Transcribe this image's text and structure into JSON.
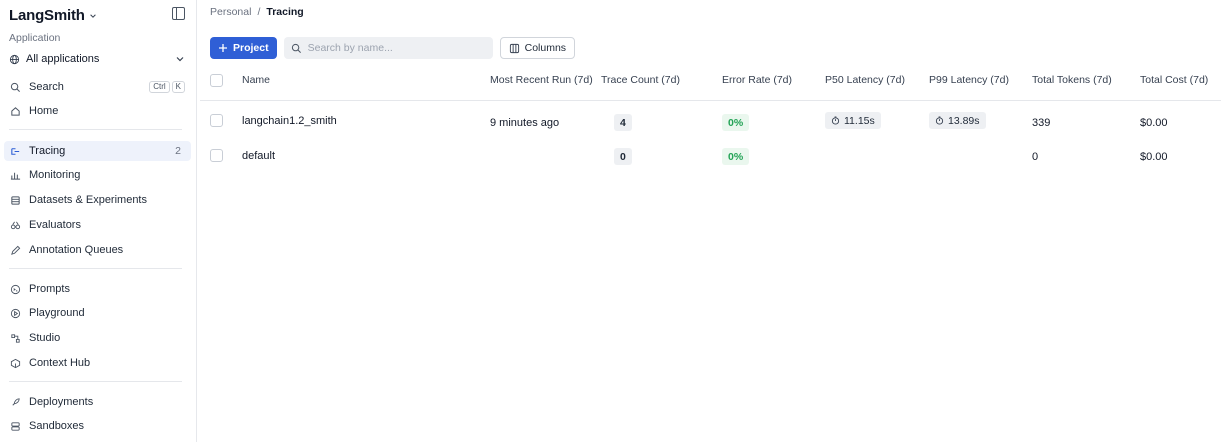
{
  "sidebar": {
    "brand": "LangSmith",
    "section_label": "Application",
    "app_selector": "All applications",
    "search": {
      "label": "Search",
      "kbd": [
        "Ctrl",
        "K"
      ]
    },
    "items": [
      {
        "label": "Home",
        "icon": "home-icon"
      },
      {
        "label": "Tracing",
        "icon": "tracing-icon",
        "count": "2"
      },
      {
        "label": "Monitoring",
        "icon": "monitoring-icon"
      },
      {
        "label": "Datasets & Experiments",
        "icon": "database-icon"
      },
      {
        "label": "Evaluators",
        "icon": "evaluators-icon"
      },
      {
        "label": "Annotation Queues",
        "icon": "pen-icon"
      },
      {
        "label": "Prompts",
        "icon": "prompt-icon"
      },
      {
        "label": "Playground",
        "icon": "playground-icon"
      },
      {
        "label": "Studio",
        "icon": "studio-icon"
      },
      {
        "label": "Context Hub",
        "icon": "hub-icon"
      },
      {
        "label": "Deployments",
        "icon": "rocket-icon"
      },
      {
        "label": "Sandboxes",
        "icon": "sandbox-icon"
      }
    ]
  },
  "breadcrumb": {
    "parent": "Personal",
    "separator": "/",
    "current": "Tracing"
  },
  "toolbar": {
    "project_label": "Project",
    "search_placeholder": "Search by name...",
    "columns_label": "Columns"
  },
  "table": {
    "columns": [
      "Name",
      "Most Recent Run (7d)",
      "Trace Count (7d)",
      "Error Rate (7d)",
      "P50 Latency (7d)",
      "P99 Latency (7d)",
      "Total Tokens (7d)",
      "Total Cost (7d)"
    ],
    "rows": [
      {
        "name": "langchain1.2_smith",
        "recent": "9 minutes ago",
        "trace_count": "4",
        "error_rate": "0%",
        "p50": "11.15s",
        "p99": "13.89s",
        "tokens": "339",
        "cost": "$0.00"
      },
      {
        "name": "default",
        "recent": "",
        "trace_count": "0",
        "error_rate": "0%",
        "p50": "",
        "p99": "",
        "tokens": "0",
        "cost": "$0.00"
      }
    ]
  },
  "colors": {
    "accent": "#2f5fd6",
    "active_bg": "#eef2fb",
    "success": "#23a356"
  }
}
